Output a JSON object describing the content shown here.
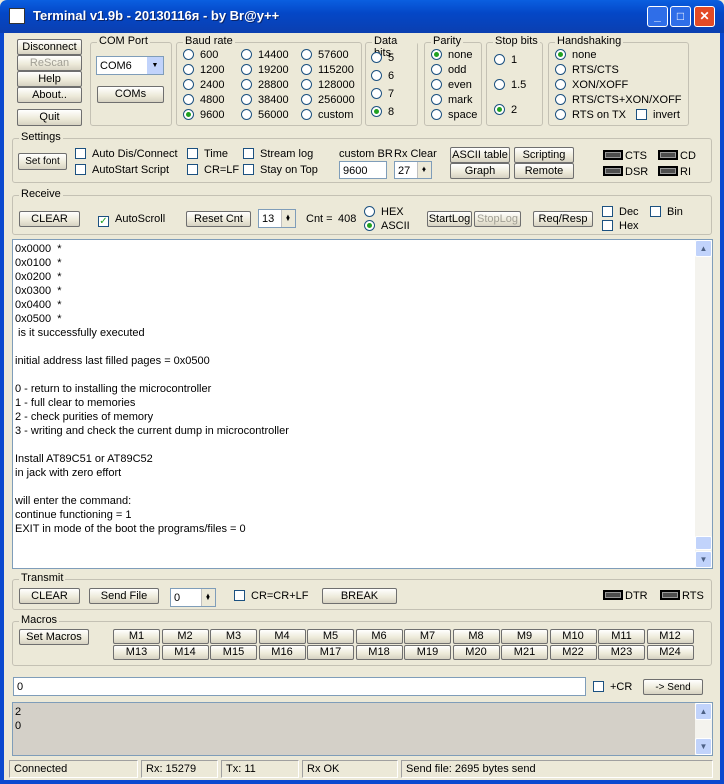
{
  "window": {
    "title": "Terminal v1.9b - 20130116я - by Br@y++",
    "min": "_",
    "max": "□",
    "close": "✕"
  },
  "left_buttons": {
    "disconnect": "Disconnect",
    "rescan": "ReScan",
    "help": "Help",
    "about": "About..",
    "quit": "Quit"
  },
  "com_port": {
    "label": "COM Port",
    "value": "COM6",
    "coms": "COMs"
  },
  "baud": {
    "label": "Baud rate",
    "options": [
      "600",
      "14400",
      "57600",
      "1200",
      "19200",
      "115200",
      "2400",
      "28800",
      "128000",
      "4800",
      "38400",
      "256000",
      "9600",
      "56000",
      "custom"
    ],
    "selected": "9600"
  },
  "data_bits": {
    "label": "Data bits",
    "options": [
      "5",
      "6",
      "7",
      "8"
    ],
    "selected": "8"
  },
  "parity": {
    "label": "Parity",
    "options": [
      "none",
      "odd",
      "even",
      "mark",
      "space"
    ],
    "selected": "none"
  },
  "stop_bits": {
    "label": "Stop bits",
    "options": [
      "1",
      "1.5",
      "2"
    ],
    "selected": "2"
  },
  "handshaking": {
    "label": "Handshaking",
    "options": [
      "none",
      "RTS/CTS",
      "XON/XOFF",
      "RTS/CTS+XON/XOFF",
      "RTS on TX"
    ],
    "selected": "none",
    "invert": "invert"
  },
  "settings": {
    "label": "Settings",
    "set_font": "Set font",
    "auto_dis": "Auto Dis/Connect",
    "autostart": "AutoStart Script",
    "time": "Time",
    "crlf": "CR=LF",
    "stream_log": "Stream log",
    "stay_on_top": "Stay on Top",
    "custom_br_label": "custom BR",
    "custom_br_value": "9600",
    "rx_clear_label": "Rx Clear",
    "rx_clear_value": "27",
    "ascii_table": "ASCII table",
    "graph": "Graph",
    "scripting": "Scripting",
    "remote": "Remote",
    "cts": "CTS",
    "cd": "CD",
    "dsr": "DSR",
    "ri": "RI"
  },
  "receive": {
    "label": "Receive",
    "clear": "CLEAR",
    "autoscroll": "AutoScroll",
    "reset_cnt": "Reset Cnt",
    "cnt_value": "13",
    "cnt_label": "Cnt =",
    "cnt": "408",
    "hex": "HEX",
    "ascii": "ASCII",
    "startlog": "StartLog",
    "stoplog": "StopLog",
    "req_resp": "Req/Resp",
    "dec": "Dec",
    "hex2": "Hex",
    "bin": "Bin"
  },
  "terminal_lines": [
    "0x0000  *",
    "0x0100  *",
    "0x0200  *",
    "0x0300  *",
    "0x0400  *",
    "0x0500  *",
    " is it successfully executed",
    "",
    "initial address last filled pages = 0x0500",
    "",
    "0 - return to installing the microcontroller",
    "1 - full clear to memories",
    "2 - check purities of memory",
    "3 - writing and check the current dump in microcontroller",
    "",
    "Install AT89C51 or AT89C52",
    "in jack with zero effort",
    "",
    "will enter the command:",
    "continue functioning = 1",
    "EXIT in mode of the boot the programs/files = 0"
  ],
  "transmit": {
    "label": "Transmit",
    "clear": "CLEAR",
    "send_file": "Send File",
    "spin_value": "0",
    "crcrlf": "CR=CR+LF",
    "break": "BREAK",
    "dtr": "DTR",
    "rts": "RTS"
  },
  "macros": {
    "label": "Macros",
    "set_macros": "Set Macros",
    "items": [
      "M1",
      "M2",
      "M3",
      "M4",
      "M5",
      "M6",
      "M7",
      "M8",
      "M9",
      "M10",
      "M11",
      "M12",
      "M13",
      "M14",
      "M15",
      "M16",
      "M17",
      "M18",
      "M19",
      "M20",
      "M21",
      "M22",
      "M23",
      "M24"
    ]
  },
  "send": {
    "input_value": "0",
    "cr": "+CR",
    "send": "-> Send"
  },
  "sent_lines": [
    "2",
    "0"
  ],
  "status": {
    "connected": "Connected",
    "rx": "Rx: 15279",
    "tx": "Tx: 11",
    "rx_ok": "Rx OK",
    "send_file": "Send file: 2695 bytes send"
  }
}
